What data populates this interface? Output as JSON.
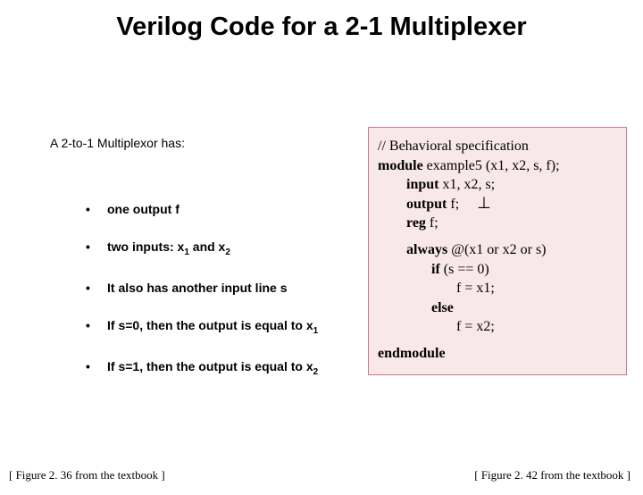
{
  "title": "Verilog Code for a 2-1 Multiplexer",
  "lead": "A 2-to-1 Multiplexor has:",
  "bullets": {
    "b1": "one output f",
    "b2_pre": "two inputs: x",
    "b2_mid": " and x",
    "b3": "It also has another input line s",
    "b4_pre": "If s=0, then the output is equal to x",
    "b5_pre": "If s=1, then the output is equal to x"
  },
  "code": {
    "comment": "// Behavioral specification",
    "module_kw": "module",
    "module_rest": "  example5 (x1, x2, s, f);",
    "input_kw": "input",
    "input_rest": "  x1, x2, s;",
    "output_kw": "output",
    "output_rest": "  f;",
    "reg_kw": "reg",
    "reg_rest": "  f;",
    "always_kw": "always",
    "always_rest": " @(x1 or x2 or s)",
    "if_kw": "if",
    "if_rest": " (s == 0)",
    "assign1": "f = x1;",
    "else_kw": "else",
    "assign2": "f = x2;",
    "endmodule": "endmodule"
  },
  "captions": {
    "left": "[ Figure 2. 36 from the textbook ]",
    "right": "[ Figure 2. 42 from the textbook ]"
  }
}
